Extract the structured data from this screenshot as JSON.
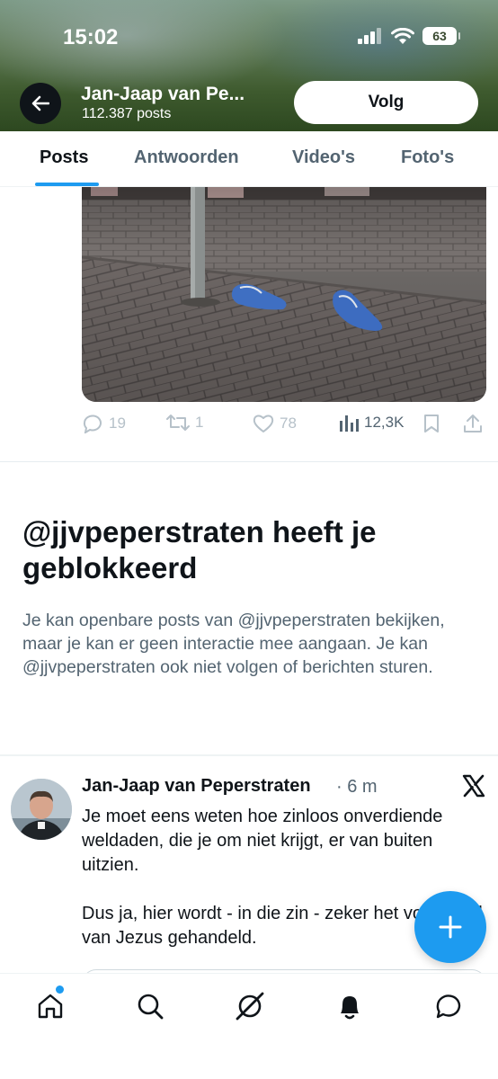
{
  "status_bar": {
    "time": "15:02",
    "battery": "63"
  },
  "profile_header": {
    "name": "Jan-Jaap van Pe...",
    "post_count": "112.387 posts",
    "follow_label": "Volg"
  },
  "tabs": [
    {
      "label": "Posts",
      "active": true
    },
    {
      "label": "Antwoorden",
      "active": false
    },
    {
      "label": "Video's",
      "active": false
    },
    {
      "label": "Foto's",
      "active": false
    }
  ],
  "previous_post": {
    "image": "photo-blue-shoes-on-brick-pavement",
    "replies": "19",
    "reposts": "1",
    "likes": "78",
    "views": "12,3K"
  },
  "blocked_notice": {
    "title": "@jjvpeperstraten heeft je geblokkeerd",
    "body": "Je kan openbare posts van @jjvpeperstraten bekijken, maar je kan er geen interactie mee aangaan. Je kan @jjvpeperstraten ook niet volgen of berichten sturen."
  },
  "next_post": {
    "author": "Jan-Jaap van Peperstraten",
    "time": "· 6 m",
    "paragraph_1": "Je moet eens weten hoe zinloos onverdiende weldaden, die je om niet krijgt, er van buiten uitzien.",
    "paragraph_2": "Dus ja, hier wordt -  in die zin -  zeker het voorbeeld van Jezus gehandeld."
  },
  "colors": {
    "accent": "#1d9bf0",
    "text_primary": "#0f1419",
    "text_secondary": "#536471"
  },
  "bottom_nav": [
    "home-icon",
    "search-icon",
    "grok-icon",
    "notifications-icon",
    "messages-icon"
  ]
}
